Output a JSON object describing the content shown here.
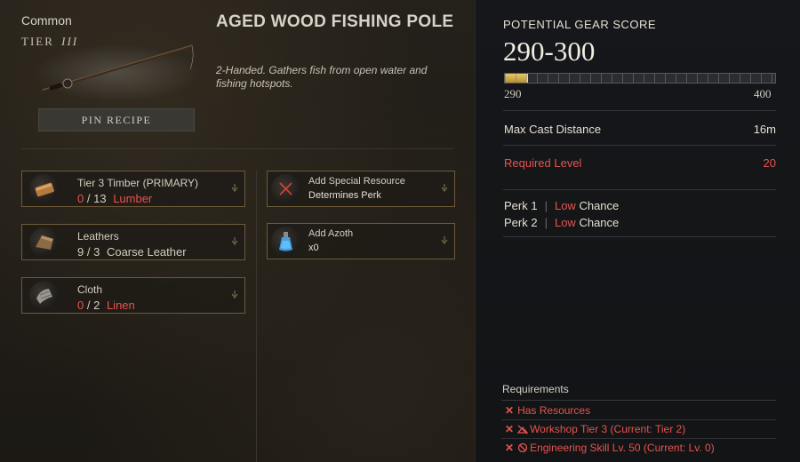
{
  "item": {
    "rarity": "Common",
    "tier_label": "TIER",
    "tier_roman": "III",
    "title": "AGED WOOD FISHING POLE",
    "description": "2-Handed. Gathers fish from open water and fishing hotspots.",
    "pin_button": "PIN RECIPE"
  },
  "resources": [
    {
      "name": "Tier 3 Timber (PRIMARY)",
      "have": "0",
      "need": "13",
      "material": "Lumber",
      "insufficient": true,
      "icon": "lumber-icon"
    },
    {
      "name": "Leathers",
      "have": "9",
      "need": "3",
      "material": "Coarse Leather",
      "insufficient": false,
      "icon": "leather-icon"
    },
    {
      "name": "Cloth",
      "have": "0",
      "need": "2",
      "material": "Linen",
      "insufficient": true,
      "icon": "linen-icon"
    }
  ],
  "optional": [
    {
      "name": "Add Special Resource",
      "sub": "Determines Perk",
      "icon": "empty-slot-x-icon"
    },
    {
      "name": "Add Azoth",
      "sub": "x0",
      "icon": "azoth-flask-icon"
    }
  ],
  "gear_score": {
    "label": "POTENTIAL GEAR SCORE",
    "value": "290-300",
    "min": "290",
    "max": "400",
    "fill_fraction": 0.08
  },
  "stats": [
    {
      "label": "Max Cast Distance",
      "value": "16m",
      "warning": false
    },
    {
      "label": "Required Level",
      "value": "20",
      "warning": true
    }
  ],
  "perks": [
    {
      "label": "Perk 1",
      "chance_word": "Low",
      "chance_suffix": "Chance"
    },
    {
      "label": "Perk 2",
      "chance_word": "Low",
      "chance_suffix": "Chance"
    }
  ],
  "requirements": {
    "title": "Requirements",
    "items": [
      {
        "text": "Has Resources",
        "icon": ""
      },
      {
        "text": "Workshop Tier 3 (Current: Tier 2)",
        "icon": "workshop-icon"
      },
      {
        "text": "Engineering Skill Lv. 50 (Current: Lv. 0)",
        "icon": "engineering-icon"
      }
    ]
  },
  "colors": {
    "warning": "#e8534f",
    "border_gold": "#6e5a3a",
    "bar_fill": "#e7c86a"
  }
}
